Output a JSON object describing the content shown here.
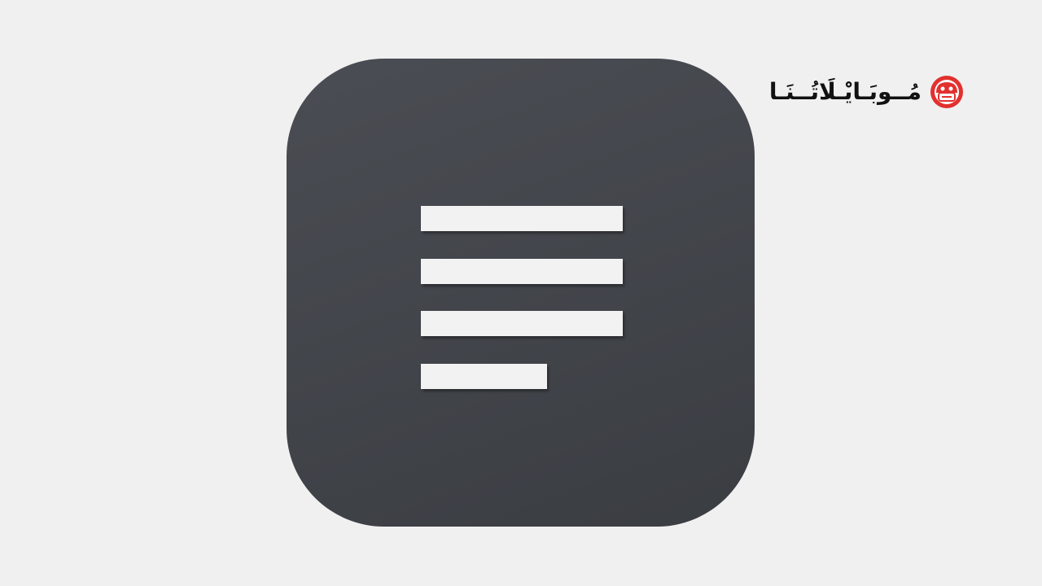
{
  "colors": {
    "page_background": "#f0f0f0",
    "icon_background": "#42454a",
    "bar_color": "#f2f2f2",
    "watermark_text": "#111111",
    "watermark_logo": "#e2312e"
  },
  "icon": {
    "name": "text-lines-icon",
    "bars": [
      {
        "length": 1.0
      },
      {
        "length": 1.0
      },
      {
        "length": 1.0
      },
      {
        "length": 0.625
      }
    ]
  },
  "watermark": {
    "text": "مُــوبَـايْـلَاتُــنَـا",
    "logo_icon": "robot-head-logo-icon"
  }
}
